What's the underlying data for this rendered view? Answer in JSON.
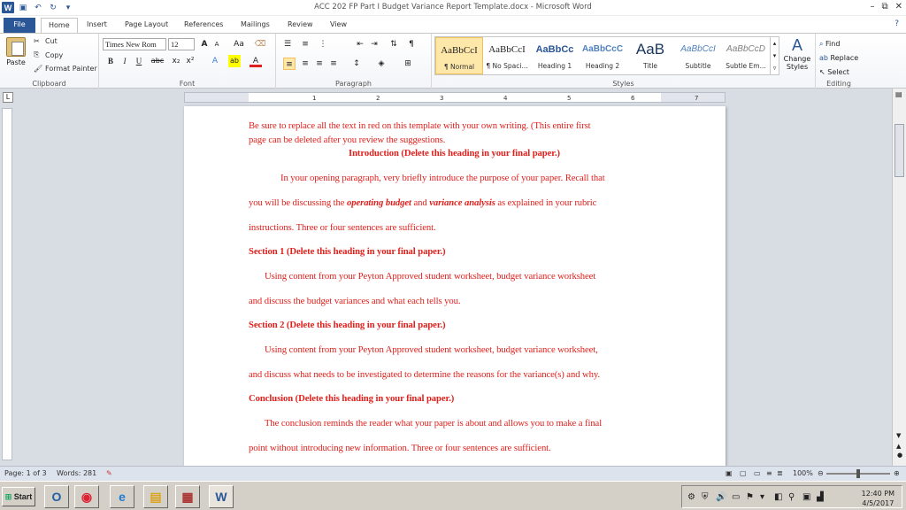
{
  "window": {
    "title": "ACC 202 FP Part I Budget Variance Report Template.docx - Microsoft Word",
    "controls": [
      "–",
      "⧉",
      "✕"
    ]
  },
  "tabs": [
    "File",
    "Home",
    "Insert",
    "Page Layout",
    "References",
    "Mailings",
    "Review",
    "View"
  ],
  "clipboard": {
    "paste": "Paste",
    "cut": "Cut",
    "copy": "Copy",
    "format_painter": "Format Painter",
    "label": "Clipboard"
  },
  "font": {
    "family": "Times New Rom",
    "size": "12",
    "label": "Font",
    "buttons": [
      "B",
      "I",
      "U",
      "abc",
      "x₂",
      "x²",
      "A",
      "ab",
      "A"
    ],
    "grow": "A",
    "shrink": "A",
    "case": "Aa"
  },
  "paragraph": {
    "label": "Paragraph",
    "pilcrow": "¶"
  },
  "styles": {
    "label": "Styles",
    "items": [
      {
        "preview": "AaBbCcI",
        "name": "¶ Normal"
      },
      {
        "preview": "AaBbCcI",
        "name": "¶ No Spaci..."
      },
      {
        "preview": "AaBbCc",
        "name": "Heading 1"
      },
      {
        "preview": "AaBbCcC",
        "name": "Heading 2"
      },
      {
        "preview": "AaB",
        "name": "Title"
      },
      {
        "preview": "AaBbCcI",
        "name": "Subtitle"
      },
      {
        "preview": "AaBbCcD",
        "name": "Subtle Em..."
      }
    ],
    "change_styles": "Change Styles"
  },
  "editing": {
    "find": "Find",
    "replace": "Replace",
    "select": "Select",
    "label": "Editing"
  },
  "ruler_numbers": [
    "1",
    "2",
    "3",
    "4",
    "5",
    "6",
    "7"
  ],
  "document": {
    "line1": "Be sure to replace all the text in red on this template with your own writing. (This  entire first",
    "line2": "page can be deleted after you review the suggestions.",
    "intro_heading": "Introduction (Delete this heading in your final paper.)",
    "p1_line1": "In your opening paragraph, very briefly introduce the purpose of your paper. Recall that",
    "p1_line2_a": "you will be discussing the ",
    "p1_line2_b": "operating budget",
    "p1_line2_c": " and ",
    "p1_line2_d": "variance analysis",
    "p1_line2_e": " as explained in your rubric",
    "p1_line3": "instructions. Three or four sentences are sufficient.",
    "s1_heading": "Section 1 (Delete this heading in your final paper.)",
    "s1_line1": "Using content from your Peyton Approved student worksheet, budget variance worksheet",
    "s1_line2": "and discuss the budget variances and what each tells you.",
    "s2_heading": "Section 2 (Delete this heading in your final paper.)",
    "s2_line1": "Using content from your Peyton Approved student worksheet, budget variance worksheet,",
    "s2_line2": "and  discuss what needs to be investigated to determine the reasons  for the variance(s)  and why.",
    "concl_heading": "Conclusion (Delete this heading in your final paper.)",
    "c_line1": "The conclusion reminds the reader what your paper is about and allows  you to make a final",
    "c_line2": "point without introducing new information. Three or four sentences are sufficient."
  },
  "status": {
    "page": "Page: 1 of 3",
    "words": "Words: 281",
    "zoom": "100%",
    "zoom_level": 1.0
  },
  "taskbar": {
    "start": "Start",
    "time": "12:40 PM",
    "date": "4/5/2017"
  }
}
